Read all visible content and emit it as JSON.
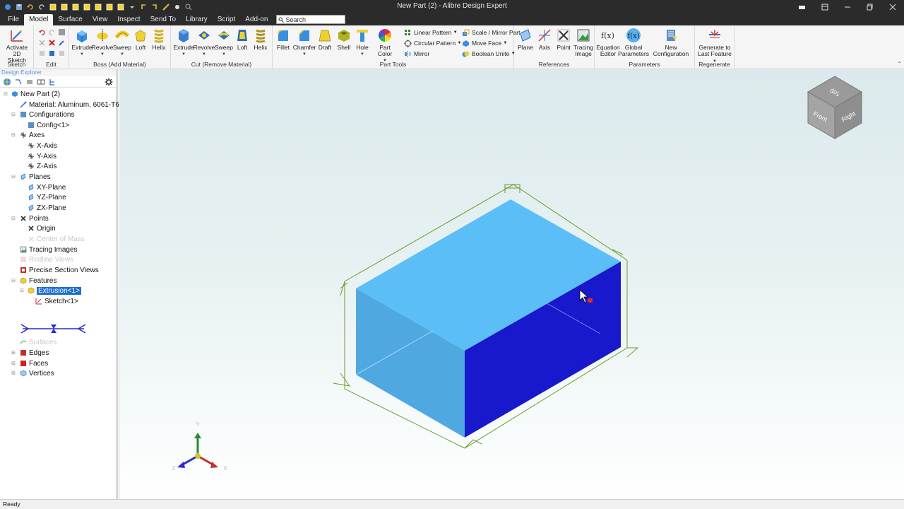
{
  "window": {
    "title": "New Part (2) - Alibre Design Expert"
  },
  "menu": {
    "tabs": [
      "File",
      "Model",
      "Surface",
      "View",
      "Inspect",
      "Send To",
      "Library",
      "Script",
      "Add-on"
    ],
    "active": "Model",
    "search_placeholder": "Search"
  },
  "ribbon": {
    "sketch": {
      "activate_line1": "Activate",
      "activate_line2": "2D Sketch",
      "group": "Sketch"
    },
    "edit": {
      "group": "Edit"
    },
    "boss": {
      "group": "Boss (Add Material)",
      "buttons": [
        "Extrude",
        "Revolve",
        "Sweep",
        "Loft",
        "Helix"
      ]
    },
    "cut": {
      "group": "Cut (Remove Material)",
      "buttons": [
        "Extrude",
        "Revolve",
        "Sweep",
        "Loft",
        "Helix"
      ]
    },
    "part_tools": {
      "group": "Part Tools",
      "buttons": [
        "Fillet",
        "Chamfer",
        "Draft",
        "Shell",
        "Hole"
      ],
      "part_color_line1": "Part Color",
      "pattern": [
        "Linear Pattern",
        "Circular Pattern",
        "Mirror"
      ],
      "misc": [
        "Scale / Mirror Part",
        "Move Face",
        "Boolean Unite"
      ]
    },
    "references": {
      "group": "References",
      "plane": "Plane",
      "axis": "Axis",
      "point": "Point",
      "tracing_line1": "Tracing",
      "tracing_line2": "Image"
    },
    "parameters": {
      "group": "Parameters",
      "equation_line1": "Equation",
      "equation_line2": "Editor",
      "global_line1": "Global",
      "global_line2": "Parameters",
      "new_config": "New Configuration"
    },
    "regenerate": {
      "group": "Regenerate",
      "line1": "Generate to",
      "line2": "Last Feature"
    }
  },
  "explorer": {
    "title": "Design Explorer",
    "tree": {
      "root": "New Part (2)",
      "material": "Material: Aluminum, 6061-T6",
      "configurations": "Configurations",
      "config1": "Config<1>",
      "axes": "Axes",
      "x_axis": "X-Axis",
      "y_axis": "Y-Axis",
      "z_axis": "Z-Axis",
      "planes": "Planes",
      "xy_plane": "XY-Plane",
      "yz_plane": "YZ-Plane",
      "zx_plane": "ZX-Plane",
      "points": "Points",
      "origin": "Origin",
      "center_of_mass": "Center of Mass",
      "tracing_images": "Tracing Images",
      "redline_views": "Redline Views",
      "precise_section_views": "Precise Section Views",
      "features": "Features",
      "extrusion1": "Extrusion<1>",
      "sketch1": "Sketch<1>",
      "surfaces": "Surfaces",
      "edges": "Edges",
      "faces": "Faces",
      "vertices": "Vertices"
    }
  },
  "viewcube": {
    "top": "Top",
    "front": "Front",
    "right": "Right"
  },
  "triad": {
    "x": "X",
    "y": "Y",
    "z": "Z"
  },
  "colors": {
    "box_top": "#5cbef7",
    "box_left": "#4fa8e0",
    "box_right": "#1818cc",
    "plane_outline": "#6a9a2a",
    "selection": "#1e6fd0"
  },
  "status": {
    "text": "Ready"
  }
}
